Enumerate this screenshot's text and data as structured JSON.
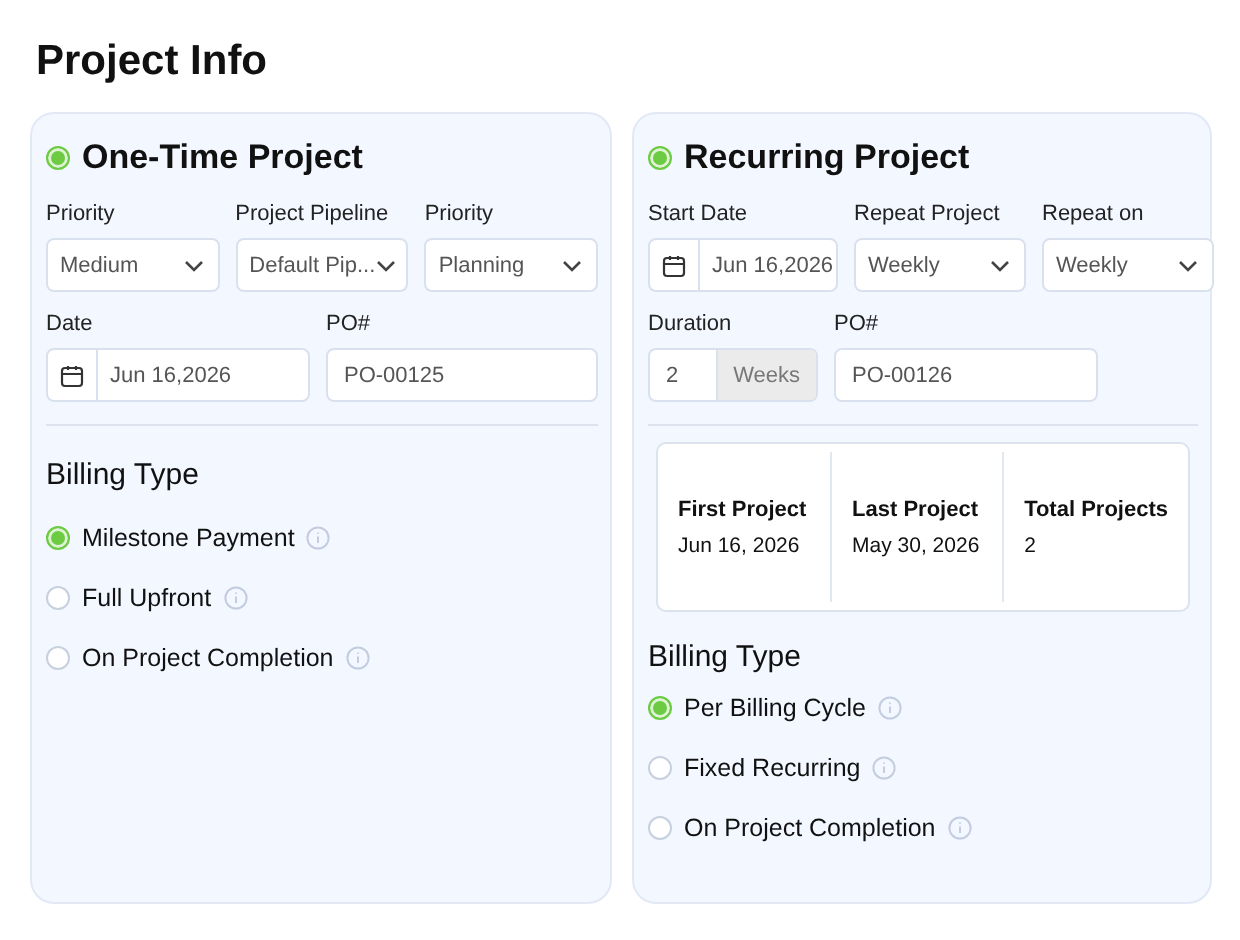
{
  "title": "Project Info",
  "panels": [
    {
      "title": "One-Time Project",
      "selected": true,
      "rows": [
        {
          "fields": [
            {
              "kind": "select",
              "label": "Priority",
              "value": "Medium"
            },
            {
              "kind": "select",
              "label": "Project Pipeline",
              "value": "Default Pip..."
            },
            {
              "kind": "select",
              "label": "Priority",
              "value": "Planning"
            }
          ]
        },
        {
          "fields": [
            {
              "kind": "date",
              "label": "Date",
              "value": "Jun 16,2026"
            },
            {
              "kind": "text",
              "label": "PO#",
              "value": "PO-00125"
            }
          ]
        }
      ],
      "billing": {
        "title": "Billing Type",
        "options": [
          {
            "label": "Milestone Payment",
            "selected": true
          },
          {
            "label": "Full Upfront",
            "selected": false
          },
          {
            "label": "On Project Completion",
            "selected": false
          }
        ]
      }
    },
    {
      "title": "Recurring Project",
      "selected": true,
      "rows": [
        {
          "fields": [
            {
              "kind": "date",
              "label": "Start Date",
              "value": "Jun 16,2026"
            },
            {
              "kind": "select",
              "label": "Repeat Project",
              "value": "Weekly"
            },
            {
              "kind": "select",
              "label": "Repeat on",
              "value": "Weekly"
            }
          ]
        },
        {
          "fields": [
            {
              "kind": "duration",
              "label": "Duration",
              "value": "2",
              "unit": "Weeks"
            },
            {
              "kind": "text",
              "label": "PO#",
              "value": "PO-00126"
            }
          ]
        }
      ],
      "summary": [
        {
          "label": "First Project",
          "value": "Jun 16, 2026"
        },
        {
          "label": "Last Project",
          "value": "May 30, 2026"
        },
        {
          "label": "Total Projects",
          "value": "2"
        }
      ],
      "billing": {
        "title": "Billing Type",
        "options": [
          {
            "label": "Per Billing Cycle",
            "selected": true
          },
          {
            "label": "Fixed Recurring",
            "selected": false
          },
          {
            "label": "On Project Completion",
            "selected": false
          }
        ]
      }
    }
  ]
}
